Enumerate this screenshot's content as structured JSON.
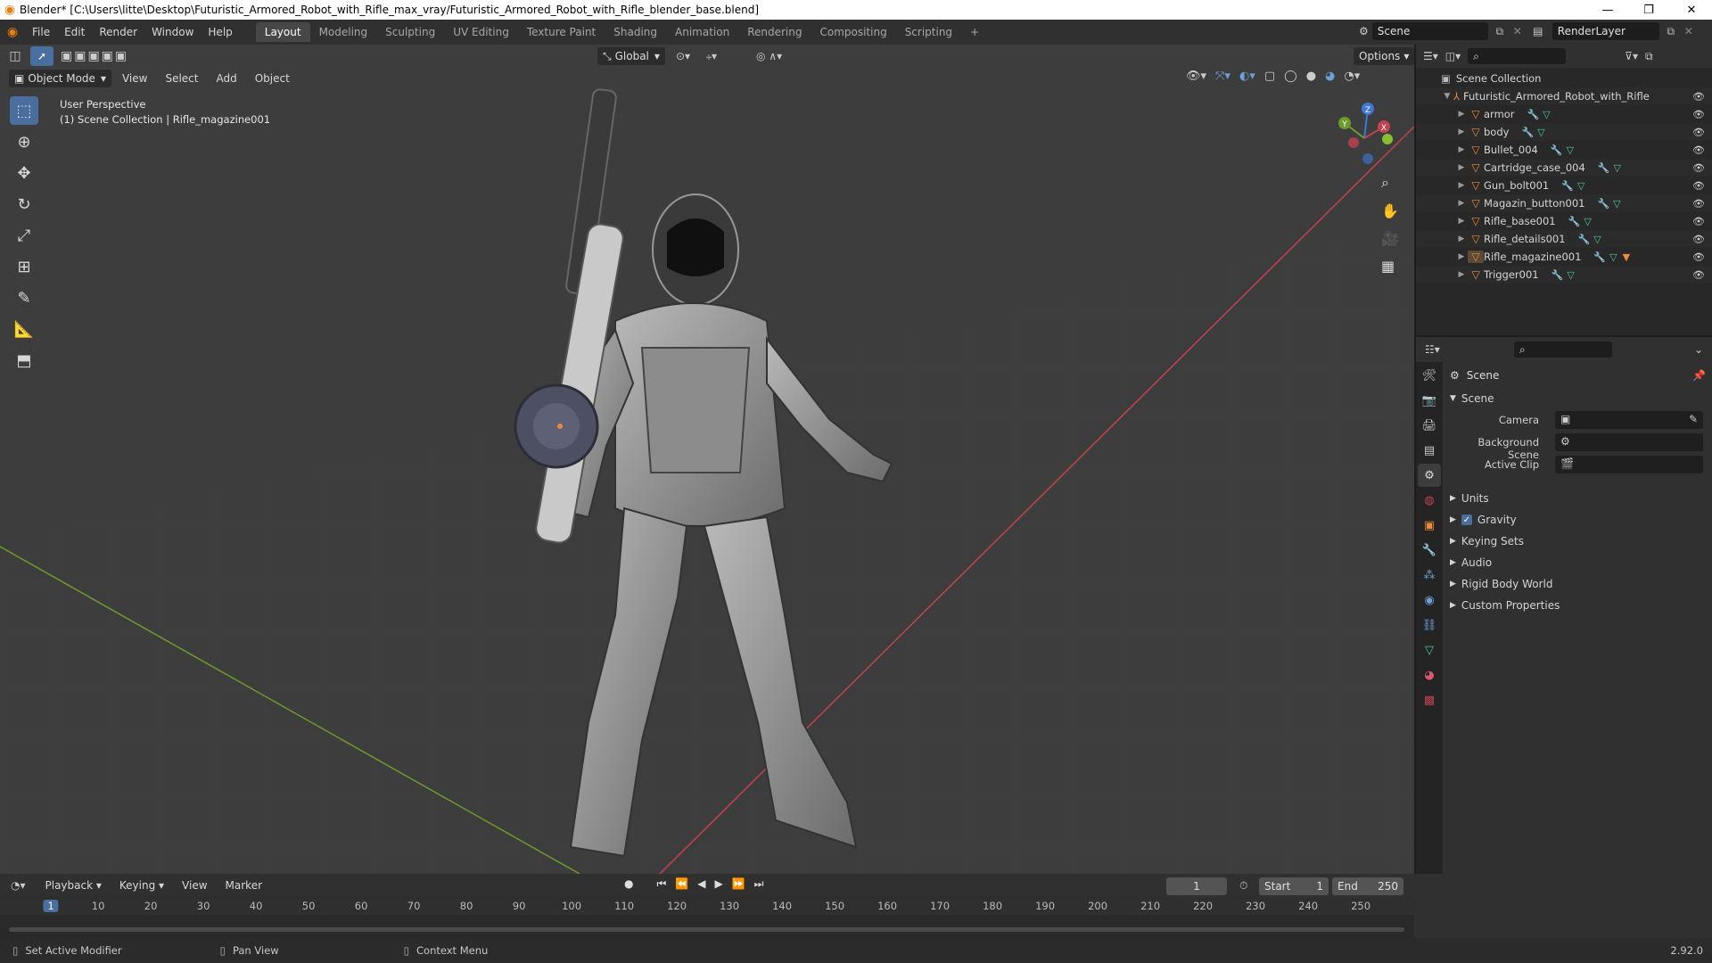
{
  "window": {
    "title": "Blender* [C:\\Users\\litte\\Desktop\\Futuristic_Armored_Robot_with_Rifle_max_vray/Futuristic_Armored_Robot_with_Rifle_blender_base.blend]",
    "minimize": "—",
    "maximize": "❐",
    "close": "✕"
  },
  "menu": {
    "items": [
      "File",
      "Edit",
      "Render",
      "Window",
      "Help"
    ],
    "workspaces": [
      "Layout",
      "Modeling",
      "Sculpting",
      "UV Editing",
      "Texture Paint",
      "Shading",
      "Animation",
      "Rendering",
      "Compositing",
      "Scripting"
    ],
    "active_workspace": "Layout",
    "add_tab": "+",
    "scene_label": "Scene",
    "render_layer": "RenderLayer"
  },
  "viewport": {
    "transform_orientation": "Global",
    "options_label": "Options",
    "mode": "Object Mode",
    "menus": [
      "View",
      "Select",
      "Add",
      "Object"
    ],
    "overlay_title": "User Perspective",
    "overlay_subtitle": "(1) Scene Collection | Rifle_magazine001",
    "gizmo": {
      "z": "Z",
      "y": "Y",
      "x": "X"
    }
  },
  "outliner": {
    "root": "Scene Collection",
    "collection": "Futuristic_Armored_Robot_with_Rifle",
    "objects": [
      "armor",
      "body",
      "Bullet_004",
      "Cartridge_case_004",
      "Gun_bolt001",
      "Magazin_button001",
      "Rifle_base001",
      "Rifle_details001",
      "Rifle_magazine001",
      "Trigger001"
    ]
  },
  "properties": {
    "context": "Scene",
    "panel": "Scene",
    "camera_label": "Camera",
    "background_scene_label": "Background Scene",
    "active_clip_label": "Active Clip",
    "subpanels": [
      "Units",
      "Gravity",
      "Keying Sets",
      "Audio",
      "Rigid Body World",
      "Custom Properties"
    ],
    "gravity_checked": true
  },
  "timeline": {
    "menus": [
      "Playback",
      "Keying",
      "View",
      "Marker"
    ],
    "current_frame": "1",
    "start_label": "Start",
    "start": "1",
    "end_label": "End",
    "end": "250",
    "ruler": [
      "1",
      "10",
      "20",
      "30",
      "40",
      "50",
      "60",
      "70",
      "80",
      "90",
      "100",
      "110",
      "120",
      "130",
      "140",
      "150",
      "160",
      "170",
      "180",
      "190",
      "200",
      "210",
      "220",
      "230",
      "240",
      "250"
    ]
  },
  "status": {
    "left": "Set Active Modifier",
    "middle": "Pan View",
    "right": "Context Menu",
    "version": "2.92.0"
  },
  "colors": {
    "accent": "#4a6e9e",
    "object_icon": "#e88b3b",
    "x_axis": "#c2424f",
    "y_axis": "#6e9a2c",
    "z_axis": "#3f77d6"
  }
}
